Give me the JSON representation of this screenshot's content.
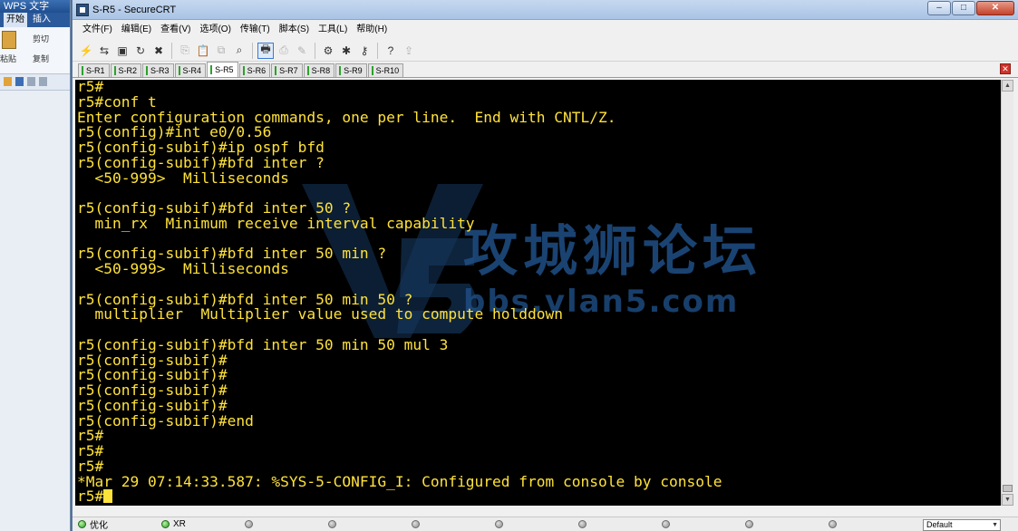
{
  "background_app": {
    "title": "WPS 文字",
    "tabs": [
      "开始",
      "插入"
    ],
    "ribbon": {
      "paste": "粘贴",
      "cut": "剪切",
      "copy": "复制"
    }
  },
  "window": {
    "title": "S-R5 - SecureCRT",
    "controls": {
      "minimize": "–",
      "maximize": "□",
      "close": "✕"
    }
  },
  "menu": [
    "文件(F)",
    "编辑(E)",
    "查看(V)",
    "选项(O)",
    "传输(T)",
    "脚本(S)",
    "工具(L)",
    "帮助(H)"
  ],
  "toolbar": [
    {
      "name": "connect-icon",
      "glyph": "⚡"
    },
    {
      "name": "quick-connect-icon",
      "glyph": "⇆"
    },
    {
      "name": "connect-tab-icon",
      "glyph": "▣"
    },
    {
      "name": "reconnect-icon",
      "glyph": "↻"
    },
    {
      "name": "disconnect-icon",
      "glyph": "✖"
    },
    {
      "name": "copy-icon",
      "glyph": "⎘",
      "dim": true
    },
    {
      "name": "paste-icon",
      "glyph": "📋"
    },
    {
      "name": "copy-paste-icon",
      "glyph": "⧉",
      "dim": true
    },
    {
      "name": "find-icon",
      "glyph": "⌕"
    },
    {
      "name": "print-icon",
      "glyph": "🖶",
      "active": true
    },
    {
      "name": "print-screen-icon",
      "glyph": "⎙",
      "dim": true
    },
    {
      "name": "log-session-icon",
      "glyph": "✎",
      "dim": true
    },
    {
      "name": "session-options-icon",
      "glyph": "⚙"
    },
    {
      "name": "global-options-icon",
      "glyph": "✱"
    },
    {
      "name": "keymap-icon",
      "glyph": "⚷"
    },
    {
      "name": "help-icon",
      "glyph": "?"
    },
    {
      "name": "sftp-icon",
      "glyph": "⇪",
      "dim": true
    }
  ],
  "tabs": [
    {
      "label": "S-R1",
      "active": false
    },
    {
      "label": "S-R2",
      "active": false
    },
    {
      "label": "S-R3",
      "active": false
    },
    {
      "label": "S-R4",
      "active": false
    },
    {
      "label": "S-R5",
      "active": true
    },
    {
      "label": "S-R6",
      "active": false
    },
    {
      "label": "S-R7",
      "active": false
    },
    {
      "label": "S-R8",
      "active": false
    },
    {
      "label": "S-R9",
      "active": false
    },
    {
      "label": "S-R10",
      "active": false
    }
  ],
  "terminal": {
    "lines": [
      "r5#",
      "r5#conf t",
      "Enter configuration commands, one per line.  End with CNTL/Z.",
      "r5(config)#int e0/0.56",
      "r5(config-subif)#ip ospf bfd",
      "r5(config-subif)#bfd inter ?",
      "  <50-999>  Milliseconds",
      "",
      "r5(config-subif)#bfd inter 50 ?",
      "  min_rx  Minimum receive interval capability",
      "",
      "r5(config-subif)#bfd inter 50 min ?",
      "  <50-999>  Milliseconds",
      "",
      "r5(config-subif)#bfd inter 50 min 50 ?",
      "  multiplier  Multiplier value used to compute holddown",
      "",
      "r5(config-subif)#bfd inter 50 min 50 mul 3",
      "r5(config-subif)#",
      "r5(config-subif)#",
      "r5(config-subif)#",
      "r5(config-subif)#",
      "r5(config-subif)#end",
      "r5#",
      "r5#",
      "r5#",
      "*Mar 29 07:14:33.587: %SYS-5-CONFIG_I: Configured from console by console"
    ],
    "prompt": "r5#",
    "text_color": "#ffe23a",
    "background": "#000000"
  },
  "watermark": {
    "logo": "V5",
    "text_cn": "攻城狮论坛",
    "url": "bbs.vlan5.com",
    "color": "#1f4f86"
  },
  "statusbar": {
    "indicators": [
      {
        "label": "优化",
        "on": true
      },
      {
        "label": "XR",
        "on": true
      },
      {
        "label": "",
        "on": false
      },
      {
        "label": "",
        "on": false
      },
      {
        "label": "",
        "on": false
      },
      {
        "label": "",
        "on": false
      },
      {
        "label": "",
        "on": false
      },
      {
        "label": "",
        "on": false
      },
      {
        "label": "",
        "on": false
      },
      {
        "label": "",
        "on": false
      }
    ],
    "select_value": "Default"
  }
}
